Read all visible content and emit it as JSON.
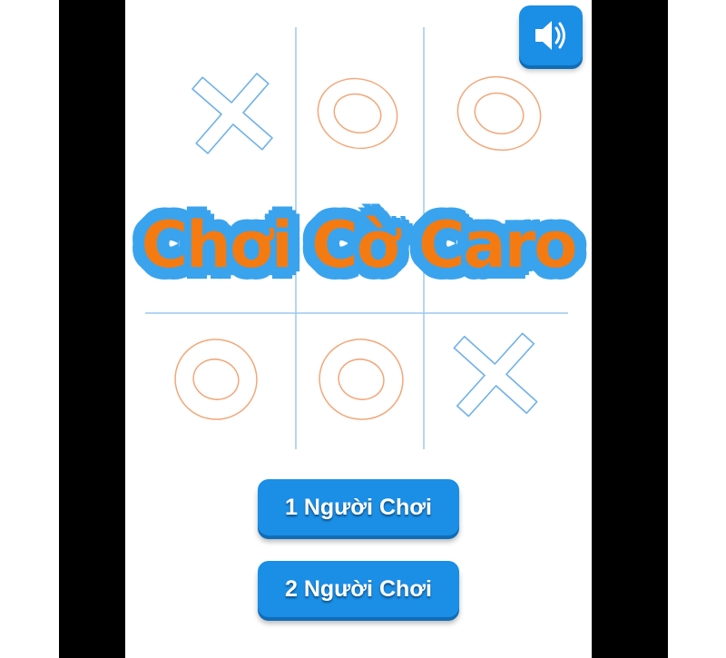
{
  "title": "Chơi Cờ Caro",
  "menu": {
    "one_player": "1 Người Chơi",
    "two_player": "2 Người Chơi"
  },
  "board": {
    "cells": [
      "X",
      "O",
      "O",
      "",
      "",
      "",
      "O",
      "O",
      "X"
    ]
  },
  "icons": {
    "sound": "speaker-icon"
  },
  "colors": {
    "button": "#1b8ee6",
    "title_fill": "#f47b12",
    "title_outline": "#3aa3ee",
    "x_mark": "#6fb1ea",
    "o_mark": "#f2a77a",
    "grid": "#9cc9ef"
  }
}
